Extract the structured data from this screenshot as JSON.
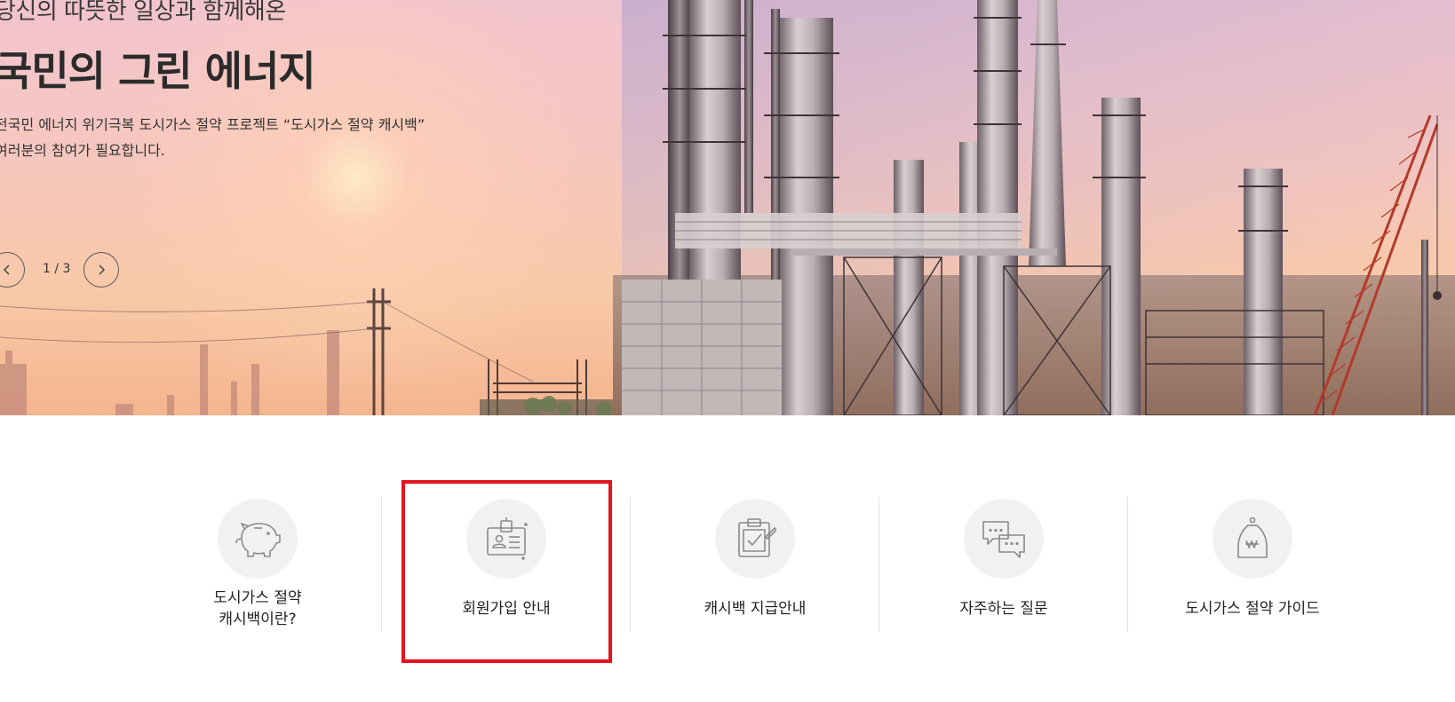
{
  "hero": {
    "eyebrow": "당신의 따뜻한 일상과 함께해온",
    "title": "국민의 그린 에너지",
    "desc_line1": "전국민 에너지 위기극복 도시가스 절약 프로젝트 “도시가스 절약 캐시백”",
    "desc_line2": "여러분의 참여가 필요합니다.",
    "slide_counter": "1 / 3",
    "prev_icon": "chevron-left-icon",
    "next_icon": "chevron-right-icon"
  },
  "quick_menu": {
    "items": [
      {
        "icon": "piggy-bank-icon",
        "label_line1": "도시가스 절약",
        "label_line2": "캐시백이란?"
      },
      {
        "icon": "id-card-icon",
        "label": "회원가입 안내",
        "highlighted": true
      },
      {
        "icon": "clipboard-check-icon",
        "label": "캐시백 지급안내"
      },
      {
        "icon": "chat-bubbles-icon",
        "label": "자주하는 질문"
      },
      {
        "icon": "money-bag-won-icon",
        "label": "도시가스 절약 가이드"
      }
    ]
  },
  "colors": {
    "highlight": "#e3141f",
    "icon_stroke": "#8a8a8a",
    "icon_bg": "#f1f1f1",
    "divider": "#e1e1e1"
  }
}
